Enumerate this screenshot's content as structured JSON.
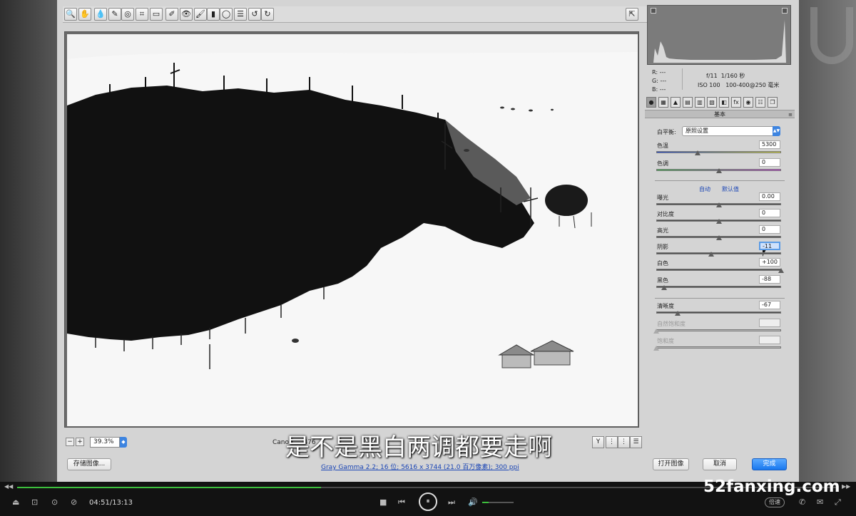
{
  "toolbar": {
    "tools": [
      {
        "name": "zoom-tool",
        "glyph": "🔍"
      },
      {
        "name": "hand-tool",
        "glyph": "✋"
      },
      {
        "name": "white-balance-tool",
        "glyph": "💧"
      },
      {
        "name": "color-sampler-tool",
        "glyph": "✎"
      },
      {
        "name": "targeted-adjustment-tool",
        "glyph": "◎"
      },
      {
        "name": "crop-tool",
        "glyph": "⌗"
      },
      {
        "name": "straighten-tool",
        "glyph": "▭"
      },
      {
        "name": "spot-removal-tool",
        "glyph": "✐"
      },
      {
        "name": "red-eye-tool",
        "glyph": "👁"
      },
      {
        "name": "adjustment-brush-tool",
        "glyph": "🖌"
      },
      {
        "name": "graduated-filter-tool",
        "glyph": "▮"
      },
      {
        "name": "radial-filter-tool",
        "glyph": "◯"
      },
      {
        "name": "preferences-tool",
        "glyph": "☰"
      },
      {
        "name": "rotate-left-tool",
        "glyph": "↺"
      },
      {
        "name": "rotate-right-tool",
        "glyph": "↻"
      }
    ],
    "fullscreen_glyph": "⇱"
  },
  "preview": {
    "zoom_value": "39.3%",
    "camera_text": "Canon",
    "camera_text_tail": "476",
    "view_buttons": [
      "Y",
      "⋮",
      "⋮",
      "☰"
    ]
  },
  "subtitle": "是不是黑白两调都要走啊",
  "footer": {
    "save_label": "存储图像...",
    "info_text": "Gray Gamma 2.2; 16 位; 5616 x 3744 (21.0 百万像素); 300 ppi",
    "open_label": "打开图像",
    "cancel_label": "取消",
    "done_label": "完成"
  },
  "info": {
    "r": "R:",
    "g": "G:",
    "b": "B:",
    "r_val": "---",
    "g_val": "---",
    "b_val": "---",
    "aperture": "f/11",
    "shutter": "1/160 秒",
    "iso": "ISO 100",
    "lens": "100-400@250 毫米"
  },
  "tabs": [
    "●",
    "▦",
    "▲",
    "▤",
    "▥",
    "▧",
    "◧",
    "fx",
    "◉",
    "☷",
    "❐"
  ],
  "panel": {
    "title": "基本",
    "menu_glyph": "≡",
    "wb_label": "白平衡:",
    "wb_value": "原照设置",
    "auto_label": "自动",
    "default_label": "默认值"
  },
  "sliders": [
    {
      "key": "temp",
      "label": "色温",
      "value": "5300",
      "pos": 0.33,
      "type": "temp"
    },
    {
      "key": "tint",
      "label": "色调",
      "value": "0",
      "pos": 0.5,
      "type": "tint"
    },
    {
      "key": "exposure",
      "label": "曝光",
      "value": "0.00",
      "pos": 0.5
    },
    {
      "key": "contrast",
      "label": "对比度",
      "value": "0",
      "pos": 0.5
    },
    {
      "key": "highlights",
      "label": "高光",
      "value": "0",
      "pos": 0.5
    },
    {
      "key": "shadows",
      "label": "阴影",
      "value": "-11",
      "pos": 0.44,
      "selected": true
    },
    {
      "key": "whites",
      "label": "白色",
      "value": "+100",
      "pos": 1.0
    },
    {
      "key": "blacks",
      "label": "黑色",
      "value": "-88",
      "pos": 0.06
    },
    {
      "key": "clarity",
      "label": "清晰度",
      "value": "-67",
      "pos": 0.17
    },
    {
      "key": "vibrance",
      "label": "自然饱和度",
      "value": "",
      "pos": 0.0,
      "disabled": true
    },
    {
      "key": "saturation",
      "label": "饱和度",
      "value": "",
      "pos": 0.0,
      "disabled": true
    }
  ],
  "player": {
    "time": "04:51/13:13",
    "progress": 0.37,
    "volume": 0.2,
    "speed_label": "倍速",
    "left_icons": [
      "⏏",
      "⊡",
      "⊙",
      "⊘"
    ],
    "stop_glyph": "■",
    "prev_glyph": "⏮",
    "pause_glyph": "⏸",
    "next_glyph": "⏭",
    "volume_glyph": "🔊",
    "right_icons": [
      "✆",
      "✉",
      "⤢"
    ]
  },
  "watermark": "52fanxing.com"
}
